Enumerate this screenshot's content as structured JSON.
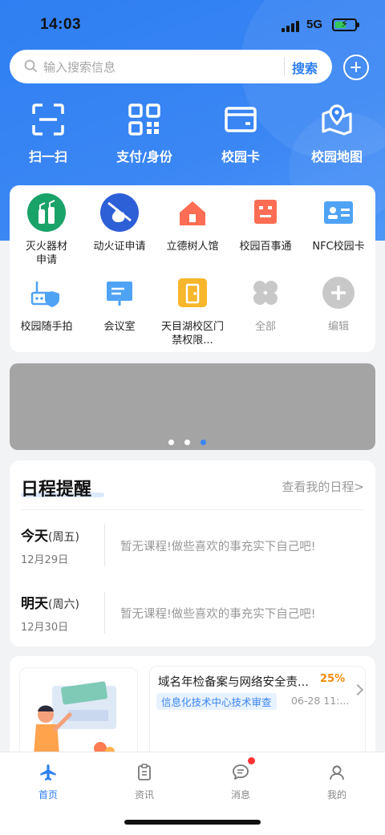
{
  "status_bar": {
    "time": "14:03",
    "network": "5G"
  },
  "search": {
    "placeholder": "输入搜索信息",
    "button": "搜索"
  },
  "quick_actions": [
    {
      "label": "扫一扫",
      "icon": "scan-icon"
    },
    {
      "label": "支付/身份",
      "icon": "qr-code-icon"
    },
    {
      "label": "校园卡",
      "icon": "card-icon"
    },
    {
      "label": "校园地图",
      "icon": "map-icon"
    }
  ],
  "apps": [
    {
      "label": "灭火器材申请",
      "icon": "fire-extinguisher-icon",
      "color": "#1aa368"
    },
    {
      "label": "动火证申请",
      "icon": "fire-permit-icon",
      "color": "#2d5fd6"
    },
    {
      "label": "立德树人馆",
      "icon": "house-icon",
      "color": "#ff6e54"
    },
    {
      "label": "校园百事通",
      "icon": "robot-icon",
      "color": "#ff6e54"
    },
    {
      "label": "NFC校园卡",
      "icon": "id-card-icon",
      "color": "#4fa3f5"
    },
    {
      "label": "校园随手拍",
      "icon": "router-shield-icon",
      "color": "#4fa3f5"
    },
    {
      "label": "会议室",
      "icon": "presentation-board-icon",
      "color": "#4fa3f5"
    },
    {
      "label": "天目湖校区门禁权限...",
      "icon": "door-icon",
      "color": "#f7b62b"
    },
    {
      "label": "全部",
      "icon": "all-apps-icon",
      "color": "#c8c8c8"
    },
    {
      "label": "编辑",
      "icon": "add-icon",
      "color": "#c8c8c8"
    }
  ],
  "banner": {
    "pages": 3,
    "active_page": 3
  },
  "schedule": {
    "title": "日程提醒",
    "link": "查看我的日程>",
    "days": [
      {
        "day": "今天",
        "weekday": "(周五)",
        "date": "12月29日",
        "note": "暂无课程!做些喜欢的事充实下自己吧!"
      },
      {
        "day": "明天",
        "weekday": "(周六)",
        "date": "12月30日",
        "note": "暂无课程!做些喜欢的事充实下自己吧!"
      }
    ]
  },
  "news": {
    "title": "域名年检备案与网络安全责...",
    "percent": "25%",
    "tag": "信息化技术中心技术审查",
    "date": "06-28 11:..."
  },
  "tabbar": [
    {
      "label": "首页",
      "icon": "airplane-icon",
      "active": true
    },
    {
      "label": "资讯",
      "icon": "clipboard-icon",
      "active": false
    },
    {
      "label": "消息",
      "icon": "chat-icon",
      "active": false,
      "badge": true
    },
    {
      "label": "我的",
      "icon": "user-icon",
      "active": false
    }
  ],
  "colors": {
    "primary": "#2f7ff2",
    "accent": "#f58a0a",
    "badge": "#ff3333"
  }
}
